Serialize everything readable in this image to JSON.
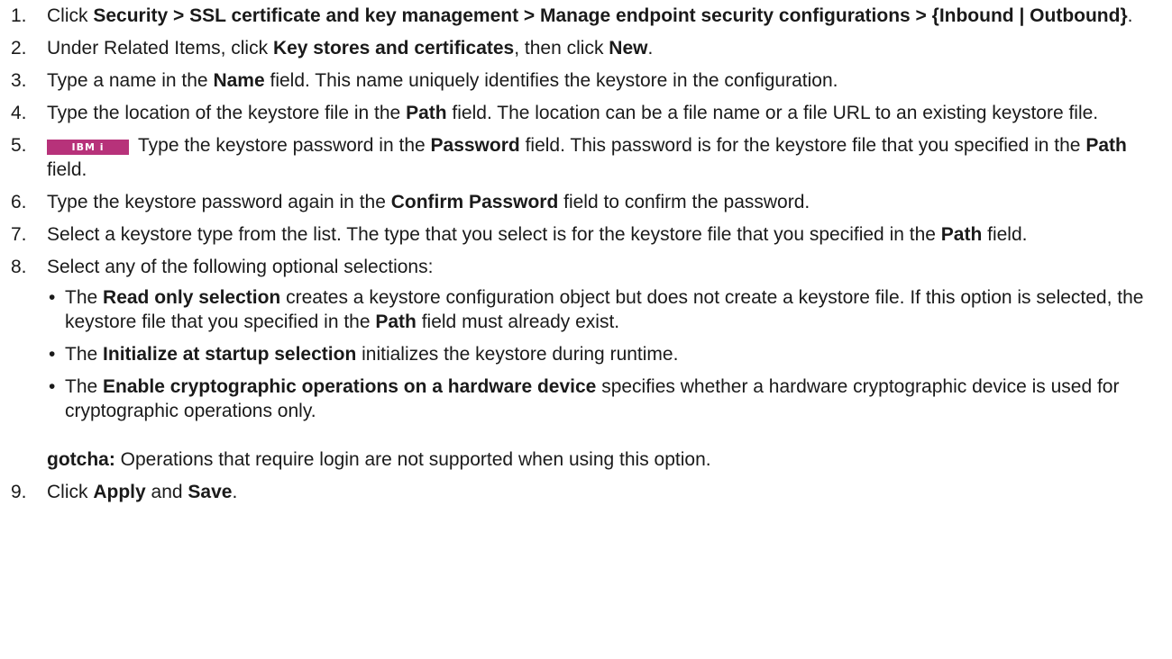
{
  "steps": [
    {
      "num": "1.",
      "parts": [
        {
          "t": "Click "
        },
        {
          "b": "Security > SSL certificate and key management > Manage endpoint security configurations > {Inbound | Outbound}"
        },
        {
          "t": "."
        }
      ]
    },
    {
      "num": "2.",
      "parts": [
        {
          "t": "Under Related Items, click "
        },
        {
          "b": "Key stores and certificates"
        },
        {
          "t": ", then click "
        },
        {
          "b": "New"
        },
        {
          "t": "."
        }
      ]
    },
    {
      "num": "3.",
      "parts": [
        {
          "t": "Type a name in the "
        },
        {
          "b": "Name"
        },
        {
          "t": " field. This name uniquely identifies the keystore in the configuration."
        }
      ]
    },
    {
      "num": "4.",
      "parts": [
        {
          "t": "Type the location of the keystore file in the "
        },
        {
          "b": "Path"
        },
        {
          "t": " field. The location can be a file name or a file URL to an existing keystore file."
        }
      ]
    },
    {
      "num": "5.",
      "badge": "IBM i",
      "parts": [
        {
          "t": "Type the keystore password in the "
        },
        {
          "b": "Password"
        },
        {
          "t": " field. This password is for the keystore file that you specified in the "
        },
        {
          "b": "Path"
        },
        {
          "t": " field."
        }
      ]
    },
    {
      "num": "6.",
      "parts": [
        {
          "t": "Type the keystore password again in the "
        },
        {
          "b": "Confirm Password"
        },
        {
          "t": " field to confirm the password."
        }
      ]
    },
    {
      "num": "7.",
      "parts": [
        {
          "t": "Select a keystore type from the list. The type that you select is for the keystore file that you specified in the "
        },
        {
          "b": "Path"
        },
        {
          "t": " field."
        }
      ]
    },
    {
      "num": "8.",
      "parts": [
        {
          "t": "Select any of the following optional selections:"
        }
      ],
      "options": [
        [
          {
            "t": "The "
          },
          {
            "b": "Read only selection"
          },
          {
            "t": " creates a keystore configuration object but does not create a keystore file. If this option is selected, the keystore file that you specified in the "
          },
          {
            "b": "Path"
          },
          {
            "t": " field must already exist."
          }
        ],
        [
          {
            "t": "The "
          },
          {
            "b": "Initialize at startup selection"
          },
          {
            "t": " initializes the keystore during runtime."
          }
        ],
        [
          {
            "t": "The "
          },
          {
            "b": "Enable cryptographic operations on a hardware device"
          },
          {
            "t": " specifies whether a hardware cryptographic device is used for cryptographic operations only."
          }
        ]
      ],
      "note": [
        {
          "b": "gotcha:"
        },
        {
          "t": "  Operations that require login are not supported when using this option."
        }
      ]
    },
    {
      "num": "9.",
      "parts": [
        {
          "t": "Click "
        },
        {
          "b": "Apply"
        },
        {
          "t": " and "
        },
        {
          "b": "Save"
        },
        {
          "t": "."
        }
      ]
    }
  ],
  "colors": {
    "text": "#1a1a1a",
    "badge_bg": "#b7327a",
    "badge_fg": "#ffffff"
  }
}
